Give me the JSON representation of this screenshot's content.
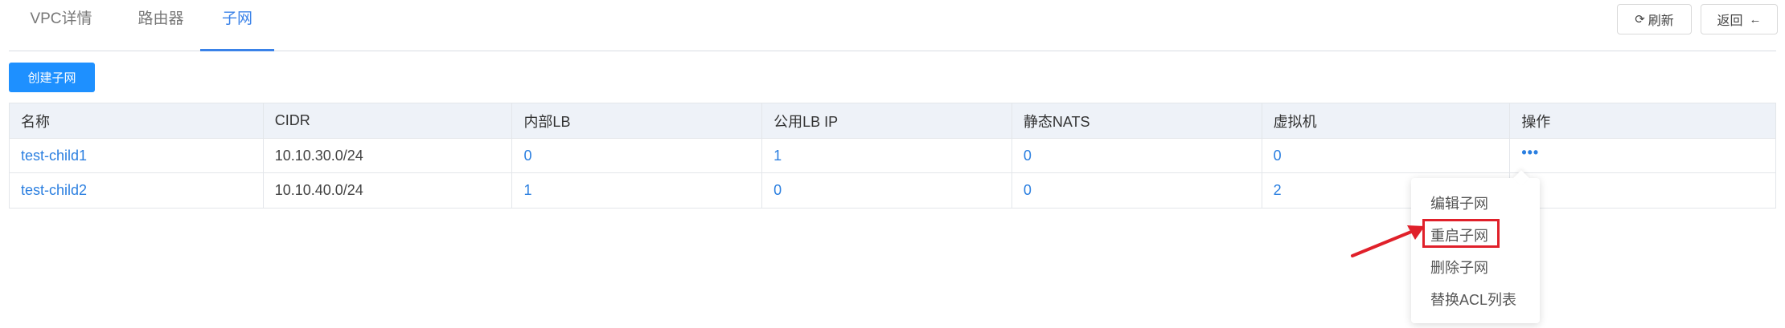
{
  "tabs": [
    {
      "label": "VPC详情",
      "active": false
    },
    {
      "label": "路由器",
      "active": false
    },
    {
      "label": "子网",
      "active": true
    }
  ],
  "toolbar": {
    "refresh_label": "刷新",
    "back_label": "返回",
    "refresh_icon": "refresh-icon",
    "back_icon": "arrow-left-icon"
  },
  "create_button": {
    "label": "创建子网",
    "color": "#1e90ff"
  },
  "table": {
    "headers": [
      "名称",
      "CIDR",
      "内部LB",
      "公用LB IP",
      "静态NATS",
      "虚拟机",
      "操作"
    ],
    "rows": [
      {
        "name": "test-child1",
        "cidr": "10.10.30.0/24",
        "internal_lb": "0",
        "public_lb_ip": "1",
        "static_nats": "0",
        "vms": "0",
        "actions": "more-icon"
      },
      {
        "name": "test-child2",
        "cidr": "10.10.40.0/24",
        "internal_lb": "1",
        "public_lb_ip": "0",
        "static_nats": "0",
        "vms": "2",
        "actions": ""
      }
    ]
  },
  "dropdown": {
    "items": [
      "编辑子网",
      "重启子网",
      "删除子网",
      "替换ACL列表"
    ],
    "highlighted_item": "重启子网",
    "annotation_color": "#e0202a"
  },
  "colors": {
    "accent": "#3a82e8",
    "link": "#2b7fe0",
    "annotation": "#e0202a"
  }
}
